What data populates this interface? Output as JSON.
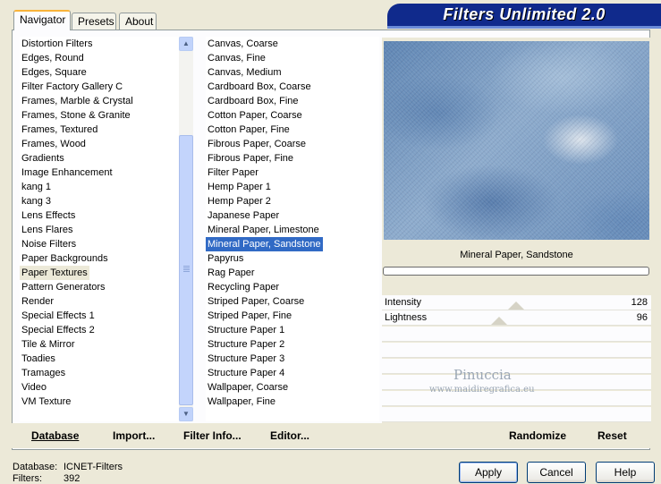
{
  "tabs": [
    "Navigator",
    "Presets",
    "About"
  ],
  "banner_title": "Filters Unlimited 2.0",
  "categories": [
    "Distortion Filters",
    "Edges, Round",
    "Edges, Square",
    "Filter Factory Gallery C",
    "Frames, Marble & Crystal",
    "Frames, Stone & Granite",
    "Frames, Textured",
    "Frames, Wood",
    "Gradients",
    "Image Enhancement",
    "kang 1",
    "kang 3",
    "Lens Effects",
    "Lens Flares",
    "Noise Filters",
    "Paper Backgrounds",
    "Paper Textures",
    "Pattern Generators",
    "Render",
    "Special Effects 1",
    "Special Effects 2",
    "Tile & Mirror",
    "Toadies",
    "Tramages",
    "Video",
    "VM Texture"
  ],
  "selected_category": "Paper Textures",
  "filters": [
    "Canvas, Coarse",
    "Canvas, Fine",
    "Canvas, Medium",
    "Cardboard Box, Coarse",
    "Cardboard Box, Fine",
    "Cotton Paper, Coarse",
    "Cotton Paper, Fine",
    "Fibrous Paper, Coarse",
    "Fibrous Paper, Fine",
    "Filter Paper",
    "Hemp Paper 1",
    "Hemp Paper 2",
    "Japanese Paper",
    "Mineral Paper, Limestone",
    "Mineral Paper, Sandstone",
    "Papyrus",
    "Rag Paper",
    "Recycling Paper",
    "Striped Paper, Coarse",
    "Striped Paper, Fine",
    "Structure Paper 1",
    "Structure Paper 2",
    "Structure Paper 3",
    "Structure Paper 4",
    "Wallpaper, Coarse",
    "Wallpaper, Fine"
  ],
  "selected_filter": "Mineral Paper, Sandstone",
  "preview_filter_name": "Mineral Paper, Sandstone",
  "parameters": [
    {
      "label": "Intensity",
      "value": "128",
      "level": 128
    },
    {
      "label": "Lightness",
      "value": "96",
      "level": 96
    }
  ],
  "commands": {
    "database": "Database",
    "import": "Import...",
    "filter_info": "Filter Info...",
    "editor": "Editor...",
    "randomize": "Randomize",
    "reset": "Reset"
  },
  "status": {
    "database_label": "Database:",
    "database_value": "ICNET-Filters",
    "filters_label": "Filters:",
    "filters_value": "392"
  },
  "buttons": {
    "apply": "Apply",
    "cancel": "Cancel",
    "help": "Help"
  },
  "watermark": {
    "name": "Pinuccia",
    "url": "www.maidiregrafica.eu"
  },
  "colors": {
    "selection": "#316ac5",
    "banner": "#102a8c",
    "window": "#ece9d8"
  }
}
